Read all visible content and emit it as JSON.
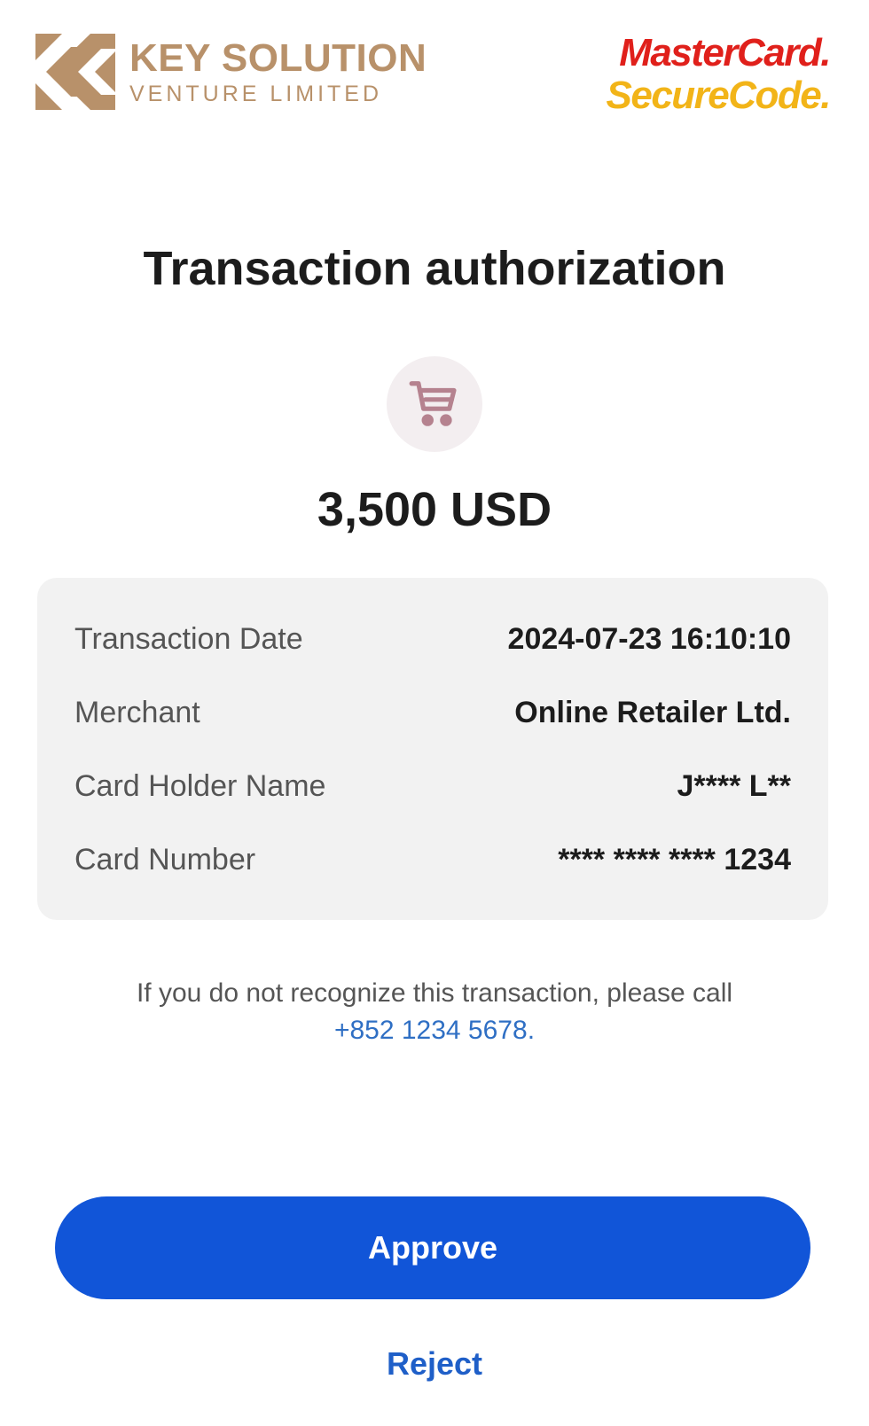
{
  "header": {
    "merchant_logo": {
      "line1": "KEY SOLUTION",
      "line2": "VENTURE LIMITED",
      "color": "#b8916a"
    },
    "scheme_logo": {
      "line1": "MasterCard.",
      "line2": "SecureCode.",
      "red": "#e0201b",
      "yellow": "#f2b418"
    }
  },
  "title": "Transaction authorization",
  "icon": "shopping-cart-icon",
  "amount": "3,500 USD",
  "details": [
    {
      "label": "Transaction Date",
      "value": "2024-07-23 16:10:10"
    },
    {
      "label": "Merchant",
      "value": "Online Retailer Ltd."
    },
    {
      "label": "Card Holder Name",
      "value": "J**** L**"
    },
    {
      "label": "Card Number",
      "value": "**** **** **** 1234"
    }
  ],
  "notice": {
    "text": "If you do not recognize this transaction, please call",
    "phone": "+852 1234 5678",
    "suffix": "."
  },
  "actions": {
    "approve_label": "Approve",
    "reject_label": "Reject",
    "primary_color": "#1155d8"
  }
}
